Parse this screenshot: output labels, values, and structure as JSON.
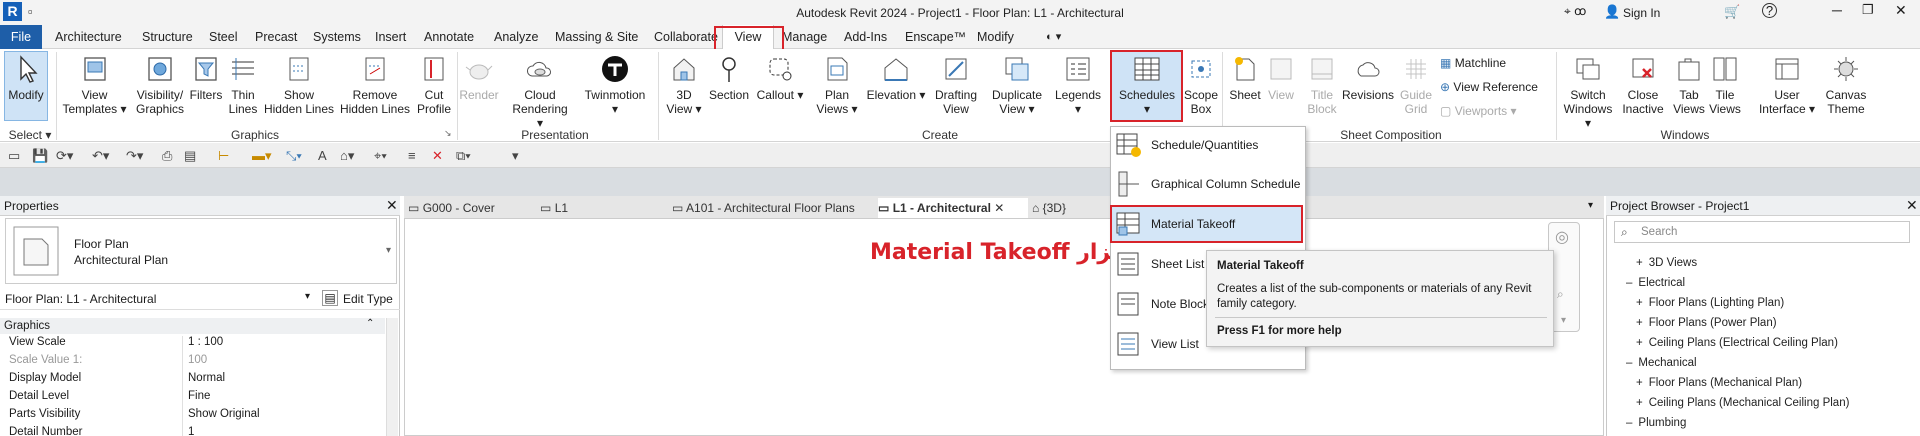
{
  "titlebar": {
    "app_icon": "R",
    "title": "Autodesk Revit 2024 - Project1 - Floor Plan: L1 - Architectural",
    "sign_in": "Sign In",
    "help": "?"
  },
  "tabs": [
    "File",
    "Architecture",
    "Structure",
    "Steel",
    "Precast",
    "Systems",
    "Insert",
    "Annotate",
    "Analyze",
    "Massing & Site",
    "Collaborate",
    "View",
    "Manage",
    "Add-Ins",
    "Enscape™",
    "Modify"
  ],
  "ribbon": {
    "select": {
      "modify": "Modify",
      "select": "Select"
    },
    "graphics": {
      "title": "Graphics",
      "tools": [
        [
          "View",
          "Templates"
        ],
        [
          "Visibility/",
          "Graphics"
        ],
        [
          "Filters",
          ""
        ],
        [
          "Thin",
          "Lines"
        ],
        [
          "Show",
          "Hidden Lines"
        ],
        [
          "Remove",
          "Hidden Lines"
        ],
        [
          "Cut",
          "Profile"
        ]
      ]
    },
    "presentation": {
      "title": "Presentation",
      "tools": [
        [
          "Render",
          ""
        ],
        [
          "Cloud",
          "Rendering"
        ],
        [
          "Twinmotion",
          ""
        ]
      ]
    },
    "create": {
      "title": "Create",
      "tools": [
        [
          "3D",
          "View"
        ],
        [
          "Section",
          ""
        ],
        [
          "Callout",
          ""
        ],
        [
          "Plan",
          "Views"
        ],
        [
          "Elevation",
          ""
        ],
        [
          "Drafting",
          "View"
        ],
        [
          "Duplicate",
          "View"
        ],
        [
          "Legends",
          ""
        ],
        [
          "Schedules",
          ""
        ],
        [
          "Scope",
          "Box"
        ]
      ]
    },
    "sheet": {
      "title": "Sheet Composition",
      "tools": [
        [
          "Sheet",
          ""
        ],
        [
          "View",
          ""
        ],
        [
          "Title",
          "Block"
        ],
        [
          "Revisions",
          ""
        ],
        [
          "Guide",
          "Grid"
        ]
      ],
      "small": [
        "Matchline",
        "View  Reference",
        "Viewports"
      ]
    },
    "windows": {
      "title": "Windows",
      "tools": [
        [
          "Switch",
          "Windows"
        ],
        [
          "Close",
          "Inactive"
        ],
        [
          "Tab",
          "Views"
        ],
        [
          "Tile",
          "Views"
        ],
        [
          "User",
          "Interface"
        ],
        [
          "Canvas",
          "Theme"
        ]
      ]
    }
  },
  "dropdown": {
    "items": [
      "Schedule/Quantities",
      "Graphical Column Schedule",
      "Material Takeoff",
      "Sheet List",
      "Note Block",
      "View List"
    ]
  },
  "tooltip": {
    "title": "Material Takeoff",
    "body": "Creates a list of the sub-components or materials of any Revit family category.",
    "footer": "Press F1 for more help"
  },
  "annotation": "ابزار Material Takeoff",
  "properties": {
    "title": "Properties",
    "type_line1": "Floor Plan",
    "type_line2": "Architectural Plan",
    "selector": "Floor Plan: L1 - Architectural",
    "edit_type": "Edit Type",
    "group": "Graphics",
    "rows": [
      {
        "k": "View Scale",
        "v": "1 : 100"
      },
      {
        "k": "Scale Value    1:",
        "v": "100"
      },
      {
        "k": "Display Model",
        "v": "Normal"
      },
      {
        "k": "Detail Level",
        "v": "Fine"
      },
      {
        "k": "Parts Visibility",
        "v": "Show Original"
      },
      {
        "k": "Detail Number",
        "v": "1"
      }
    ]
  },
  "doc_tabs": [
    "G000 - Cover",
    "L1",
    "A101 - Architectural Floor Plans",
    "L1 - Architectural",
    "{3D}"
  ],
  "project_browser": {
    "title": "Project Browser - Project1",
    "search": "Search",
    "rows": [
      {
        "t": "3D Views",
        "lvl": 2,
        "pre": "+"
      },
      {
        "t": "Electrical",
        "lvl": 1,
        "pre": "–"
      },
      {
        "t": "Floor Plans (Lighting Plan)",
        "lvl": 2,
        "pre": "+"
      },
      {
        "t": "Floor Plans (Power Plan)",
        "lvl": 2,
        "pre": "+"
      },
      {
        "t": "Ceiling Plans (Electrical Ceiling Plan)",
        "lvl": 2,
        "pre": "+"
      },
      {
        "t": "Mechanical",
        "lvl": 1,
        "pre": "–"
      },
      {
        "t": "Floor Plans (Mechanical Plan)",
        "lvl": 2,
        "pre": "+"
      },
      {
        "t": "Ceiling Plans (Mechanical Ceiling Plan)",
        "lvl": 2,
        "pre": "+"
      },
      {
        "t": "Plumbing",
        "lvl": 1,
        "pre": "–"
      }
    ]
  }
}
